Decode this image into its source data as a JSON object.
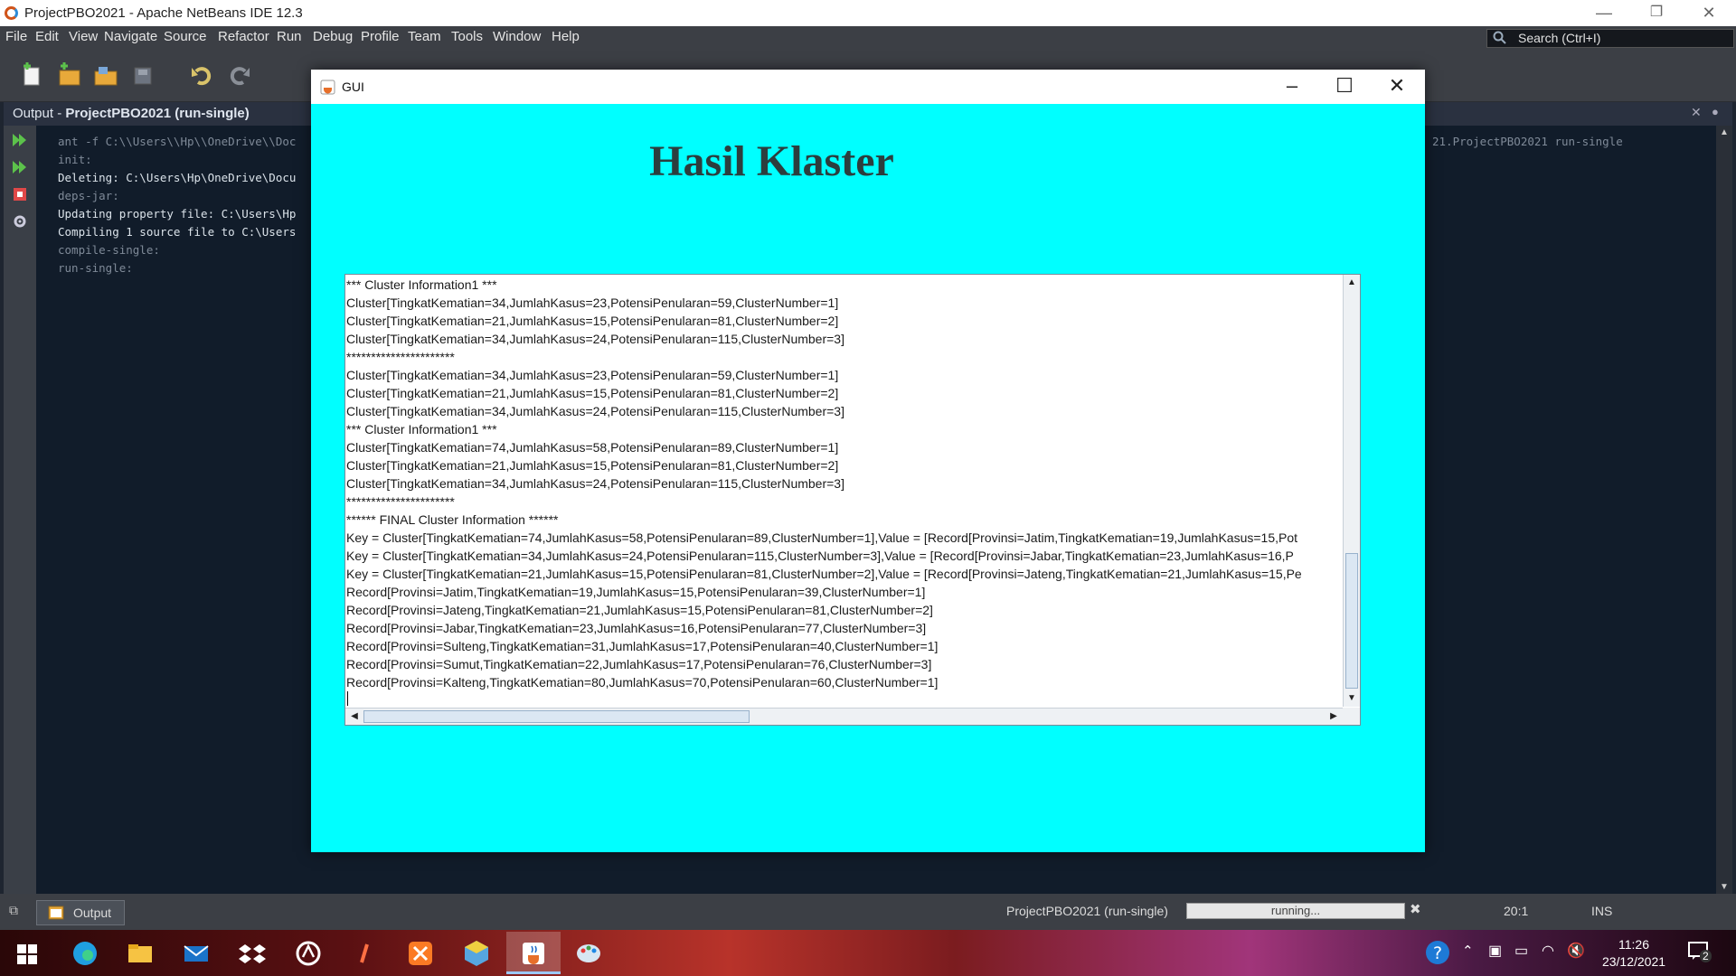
{
  "window": {
    "title": "ProjectPBO2021 - Apache NetBeans IDE 12.3",
    "minimize": "—",
    "maximize": "❐",
    "close": "✕"
  },
  "menu": [
    "File",
    "Edit",
    "View",
    "Navigate",
    "Source",
    "Refactor",
    "Run",
    "Debug",
    "Profile",
    "Team",
    "Tools",
    "Window",
    "Help"
  ],
  "search": {
    "placeholder": "Search (Ctrl+I)"
  },
  "output": {
    "tab_prefix": "Output - ",
    "tab_project": "ProjectPBO2021 (run-single)",
    "lines": [
      "ant -f C:\\\\Users\\\\Hp\\\\OneDrive\\\\Doc",
      "init:",
      "Deleting: C:\\Users\\Hp\\OneDrive\\Docu",
      "deps-jar:",
      "Updating property file: C:\\Users\\Hp",
      "Compiling 1 source file to C:\\Users",
      "compile-single:",
      "run-single:"
    ],
    "line_right": "21.ProjectPBO2021 run-single"
  },
  "statusbar": {
    "output_tab": "Output",
    "task": "ProjectPBO2021 (run-single)",
    "progress": "running...",
    "position": "20:1",
    "mode": "INS"
  },
  "taskbar": {
    "time": "11:26",
    "date": "23/12/2021",
    "notifications": "2"
  },
  "gui": {
    "title": "GUI",
    "heading": "Hasil Klaster",
    "lines": [
      "*** Cluster Information1 ***",
      "Cluster[TingkatKematian=34,JumlahKasus=23,PotensiPenularan=59,ClusterNumber=1]",
      "Cluster[TingkatKematian=21,JumlahKasus=15,PotensiPenularan=81,ClusterNumber=2]",
      "Cluster[TingkatKematian=34,JumlahKasus=24,PotensiPenularan=115,ClusterNumber=3]",
      "**********************",
      "Cluster[TingkatKematian=34,JumlahKasus=23,PotensiPenularan=59,ClusterNumber=1]",
      "Cluster[TingkatKematian=21,JumlahKasus=15,PotensiPenularan=81,ClusterNumber=2]",
      "Cluster[TingkatKematian=34,JumlahKasus=24,PotensiPenularan=115,ClusterNumber=3]",
      "*** Cluster Information1 ***",
      "Cluster[TingkatKematian=74,JumlahKasus=58,PotensiPenularan=89,ClusterNumber=1]",
      "Cluster[TingkatKematian=21,JumlahKasus=15,PotensiPenularan=81,ClusterNumber=2]",
      "Cluster[TingkatKematian=34,JumlahKasus=24,PotensiPenularan=115,ClusterNumber=3]",
      "**********************",
      "****** FINAL Cluster Information ******",
      "Key = Cluster[TingkatKematian=74,JumlahKasus=58,PotensiPenularan=89,ClusterNumber=1],Value = [Record[Provinsi=Jatim,TingkatKematian=19,JumlahKasus=15,Pot",
      "Key = Cluster[TingkatKematian=34,JumlahKasus=24,PotensiPenularan=115,ClusterNumber=3],Value = [Record[Provinsi=Jabar,TingkatKematian=23,JumlahKasus=16,P",
      "Key = Cluster[TingkatKematian=21,JumlahKasus=15,PotensiPenularan=81,ClusterNumber=2],Value = [Record[Provinsi=Jateng,TingkatKematian=21,JumlahKasus=15,Pe",
      "Record[Provinsi=Jatim,TingkatKematian=19,JumlahKasus=15,PotensiPenularan=39,ClusterNumber=1]",
      "Record[Provinsi=Jateng,TingkatKematian=21,JumlahKasus=15,PotensiPenularan=81,ClusterNumber=2]",
      "Record[Provinsi=Jabar,TingkatKematian=23,JumlahKasus=16,PotensiPenularan=77,ClusterNumber=3]",
      "Record[Provinsi=Sulteng,TingkatKematian=31,JumlahKasus=17,PotensiPenularan=40,ClusterNumber=1]",
      "Record[Provinsi=Sumut,TingkatKematian=22,JumlahKasus=17,PotensiPenularan=76,ClusterNumber=3]",
      "Record[Provinsi=Kalteng,TingkatKematian=80,JumlahKasus=70,PotensiPenularan=60,ClusterNumber=1]"
    ]
  },
  "icons": {
    "netbeans": "netbeans-logo-icon",
    "java": "java-app-icon"
  },
  "colors": {
    "gui_background": "#00ffff",
    "ide_background": "#1e2530",
    "output_background": "#111c2a"
  }
}
